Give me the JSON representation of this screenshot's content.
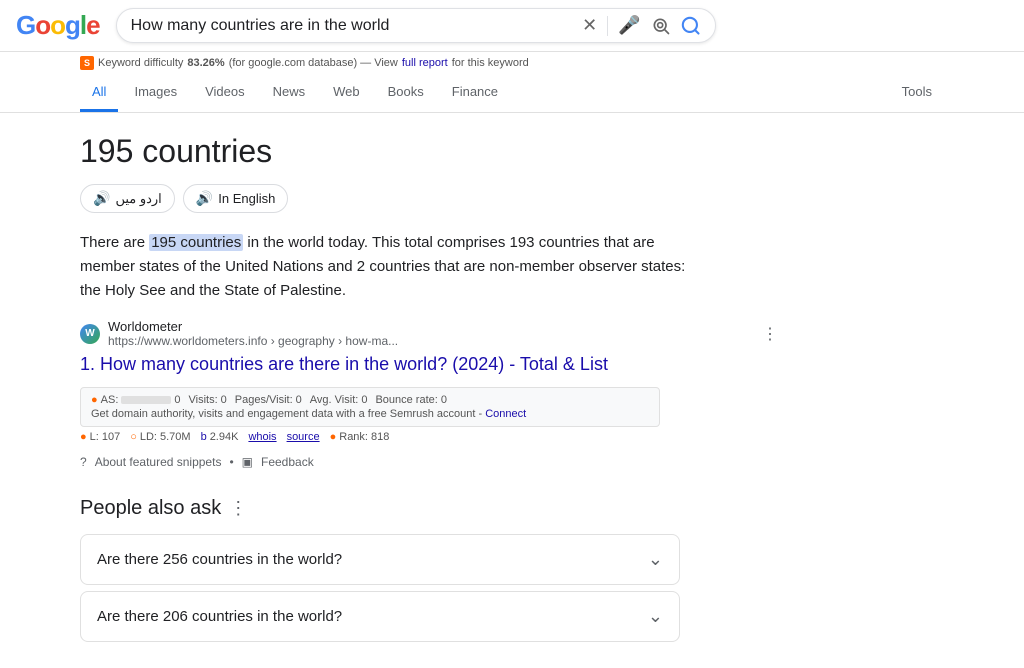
{
  "header": {
    "logo_letters": [
      "G",
      "o",
      "o",
      "g",
      "l",
      "e"
    ],
    "search_query": "How many countries are in the world"
  },
  "seo_bar": {
    "icon_label": "S",
    "text": "Keyword difficulty",
    "difficulty": "83.26%",
    "context": "(for google.com database) — View",
    "link_text": "full report",
    "suffix": "for this keyword"
  },
  "nav": {
    "tabs": [
      "All",
      "Images",
      "Videos",
      "News",
      "Web",
      "Books",
      "Finance"
    ],
    "active_tab": "All",
    "right_items": [
      "Tools"
    ]
  },
  "featured": {
    "answer": "195 countries",
    "lang_btn_arabic": "اردو میں",
    "lang_btn_english": "In English",
    "description_before": "There are ",
    "description_highlight": "195 countries",
    "description_after": " in the world today. This total comprises 193 countries that are member states of the United Nations and 2 countries that are non-member observer states: the Holy See and the State of Palestine.",
    "source": {
      "favicon_letter": "W",
      "name": "Worldometer",
      "url": "https://www.worldometers.info › geography › how-ma...",
      "menu_dots": "⋮"
    },
    "result_number": "1.",
    "result_title": "How many countries are there in the world? (2024) - Total & List",
    "seo_metrics": {
      "as_label": "AS:",
      "as_value": "0",
      "visits_label": "Visits:",
      "visits_value": "0",
      "pages_label": "Pages/Visit:",
      "pages_value": "0",
      "avg_label": "Avg. Visit:",
      "avg_value": "0",
      "bounce_label": "Bounce rate:",
      "bounce_value": "0"
    },
    "semrush_text": "Get domain authority, visits and engagement data with a free Semrush account -",
    "semrush_link": "Connect",
    "extra_metrics": {
      "l_label": "L:",
      "l_value": "107",
      "ld_label": "LD:",
      "ld_value": "5.70M",
      "b_label": "b:",
      "b_value": "2.94K",
      "whois_label": "whois",
      "source_label": "source",
      "rank_label": "Rank:",
      "rank_value": "818"
    },
    "footer": {
      "about_text": "About featured snippets",
      "separator": "•",
      "feedback_icon": "▣",
      "feedback_text": "Feedback"
    }
  },
  "people_also_ask": {
    "header": "People also ask",
    "questions": [
      "Are there 256 countries in the world?",
      "Are there 206 countries in the world?"
    ]
  }
}
